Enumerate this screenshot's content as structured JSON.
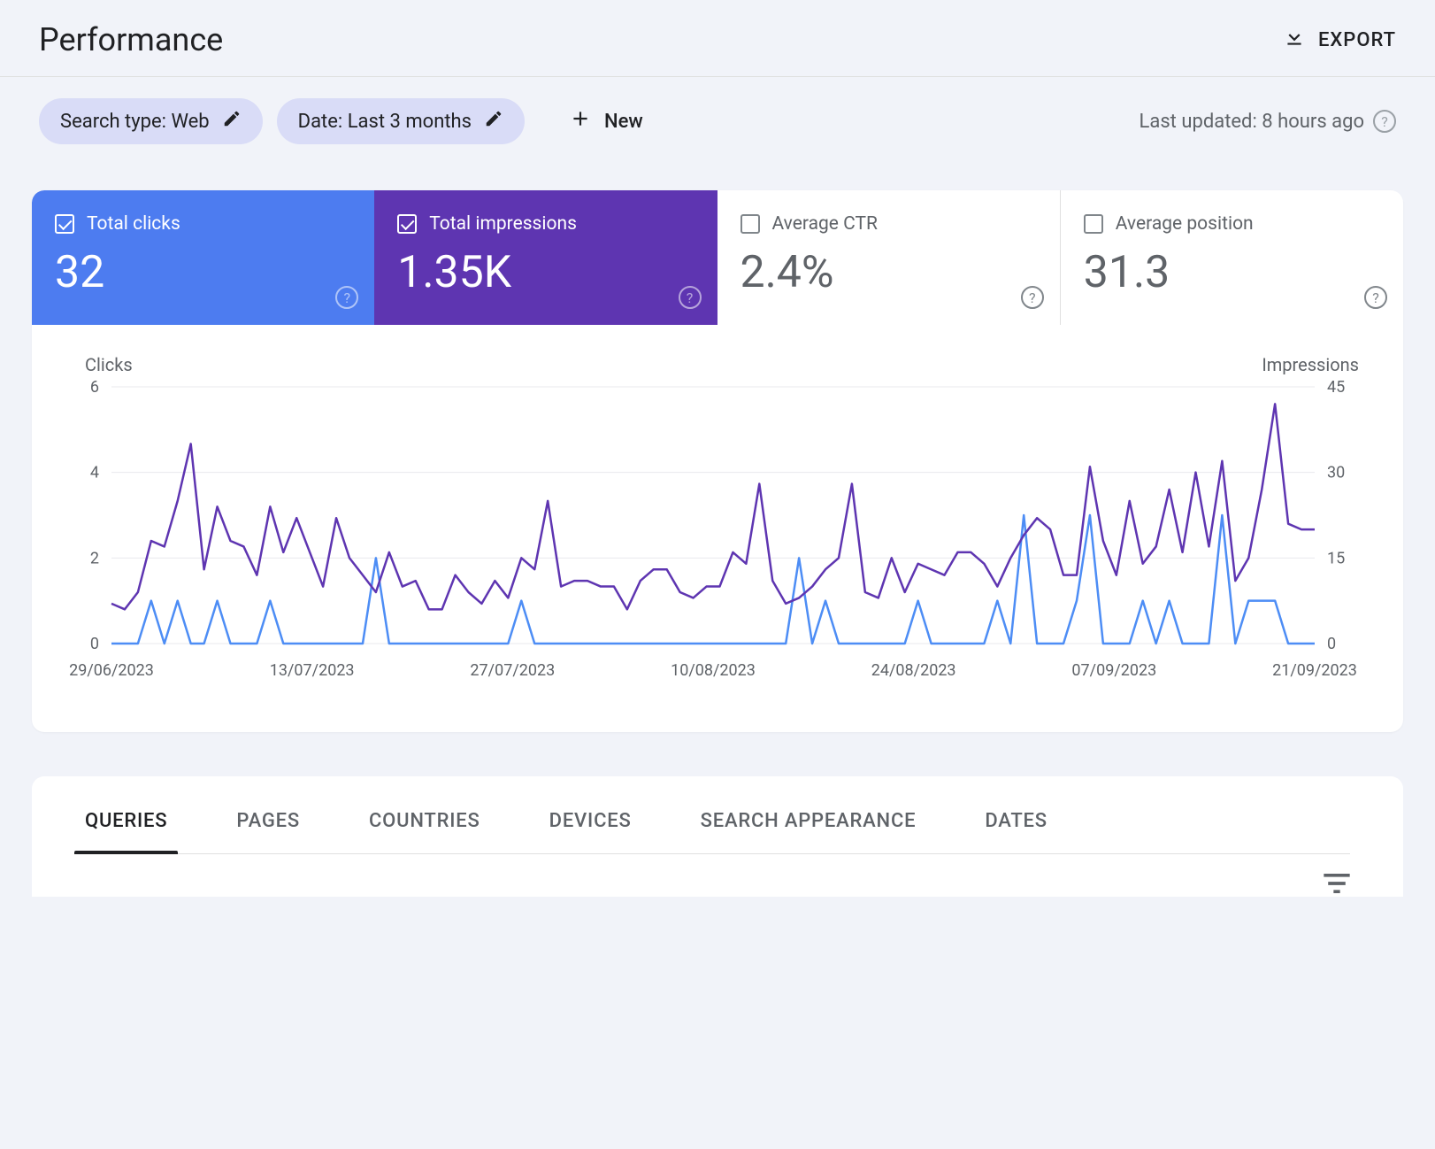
{
  "header": {
    "title": "Performance",
    "export_label": "EXPORT"
  },
  "filters": {
    "search_type_chip": "Search type: Web",
    "date_chip": "Date: Last 3 months",
    "new_label": "New",
    "last_updated": "Last updated: 8 hours ago"
  },
  "metrics": {
    "clicks": {
      "label": "Total clicks",
      "value": "32",
      "active": true
    },
    "impressions": {
      "label": "Total impressions",
      "value": "1.35K",
      "active": true
    },
    "ctr": {
      "label": "Average CTR",
      "value": "2.4%",
      "active": false
    },
    "position": {
      "label": "Average position",
      "value": "31.3",
      "active": false
    }
  },
  "chart_data": {
    "type": "line",
    "left_axis_label": "Clicks",
    "right_axis_label": "Impressions",
    "left_ticks": [
      0,
      2,
      4,
      6
    ],
    "right_ticks": [
      0,
      15,
      30,
      45
    ],
    "x_tick_labels": [
      "29/06/2023",
      "13/07/2023",
      "27/07/2023",
      "10/08/2023",
      "24/08/2023",
      "07/09/2023",
      "21/09/2023"
    ],
    "series": [
      {
        "name": "Clicks",
        "axis": "left",
        "color": "#4d8df5",
        "values": [
          0,
          0,
          0,
          1,
          0,
          1,
          0,
          0,
          1,
          0,
          0,
          0,
          1,
          0,
          0,
          0,
          0,
          0,
          0,
          0,
          2,
          0,
          0,
          0,
          0,
          0,
          0,
          0,
          0,
          0,
          0,
          1,
          0,
          0,
          0,
          0,
          0,
          0,
          0,
          0,
          0,
          0,
          0,
          0,
          0,
          0,
          0,
          0,
          0,
          0,
          0,
          0,
          2,
          0,
          1,
          0,
          0,
          0,
          0,
          0,
          0,
          1,
          0,
          0,
          0,
          0,
          0,
          1,
          0,
          3,
          0,
          0,
          0,
          1,
          3,
          0,
          0,
          0,
          1,
          0,
          1,
          0,
          0,
          0,
          3,
          0,
          1,
          1,
          1,
          0,
          0,
          0
        ]
      },
      {
        "name": "Impressions",
        "axis": "right",
        "color": "#5e35b1",
        "values": [
          7,
          6,
          9,
          18,
          17,
          25,
          35,
          13,
          24,
          18,
          17,
          12,
          24,
          16,
          22,
          16,
          10,
          22,
          15,
          12,
          9,
          16,
          10,
          11,
          6,
          6,
          12,
          9,
          7,
          11,
          8,
          15,
          13,
          25,
          10,
          11,
          11,
          10,
          10,
          6,
          11,
          13,
          13,
          9,
          8,
          10,
          10,
          16,
          14,
          28,
          11,
          7,
          8,
          10,
          13,
          15,
          28,
          9,
          8,
          15,
          9,
          14,
          13,
          12,
          16,
          16,
          14,
          10,
          15,
          19,
          22,
          20,
          12,
          12,
          31,
          18,
          12,
          25,
          14,
          17,
          27,
          16,
          30,
          17,
          32,
          11,
          15,
          27,
          42,
          21,
          20,
          20
        ]
      }
    ]
  },
  "tabs": [
    "QUERIES",
    "PAGES",
    "COUNTRIES",
    "DEVICES",
    "SEARCH APPEARANCE",
    "DATES"
  ],
  "active_tab_index": 0
}
